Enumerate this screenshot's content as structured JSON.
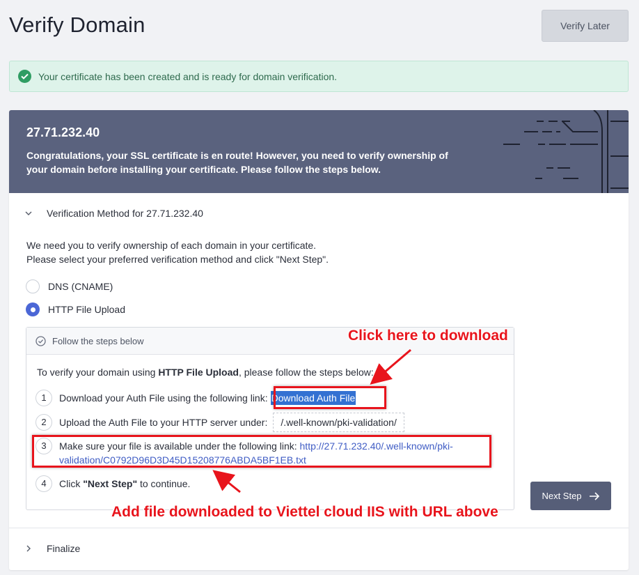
{
  "header": {
    "title": "Verify Domain",
    "verify_later_label": "Verify Later"
  },
  "alert": {
    "message": "Your certificate has been created and is ready for domain verification."
  },
  "banner": {
    "domain": "27.71.232.40",
    "message": "Congratulations, your SSL certificate is en route! However, you need to verify ownership of your domain before installing your certificate. Please follow the steps below."
  },
  "method_section": {
    "title": "Verification Method for 27.71.232.40",
    "intro_line1": "We need you to verify ownership of each domain in your certificate.",
    "intro_line2": "Please select your preferred verification method and click \"Next Step\".",
    "options": [
      {
        "label": "DNS (CNAME)",
        "selected": false
      },
      {
        "label": "HTTP File Upload",
        "selected": true
      }
    ]
  },
  "steps": {
    "header": "Follow the steps below",
    "intro_prefix": "To verify your domain using ",
    "intro_method": "HTTP File Upload",
    "intro_suffix": ", please follow the steps below:",
    "step1_num": "1",
    "step1_text": "Download your Auth File using the following link:",
    "step1_link": "Download Auth File",
    "step2_num": "2",
    "step2_text": "Upload the Auth File to your HTTP server under:",
    "step2_path": "/.well-known/pki-validation/",
    "step3_num": "3",
    "step3_text": "Make sure your file is available under the following link:",
    "step3_link_part1": "http://27.71.232.40/.well-known/pki-",
    "step3_link_part2": "validation/C0792D96D3D45D15208776ABDA5BF1EB.txt",
    "step4_num": "4",
    "step4_prefix": "Click ",
    "step4_bold": "\"Next Step\"",
    "step4_suffix": " to continue."
  },
  "next_step_label": "Next Step",
  "finalize_label": "Finalize",
  "annotations": {
    "click_here": "Click here to download",
    "add_file": "Add file downloaded to Viettel cloud IIS  with URL above"
  },
  "colors": {
    "banner": "#5a627e",
    "accent": "#4b67d6",
    "success": "#2f9d63",
    "annotation": "#e8141c"
  }
}
